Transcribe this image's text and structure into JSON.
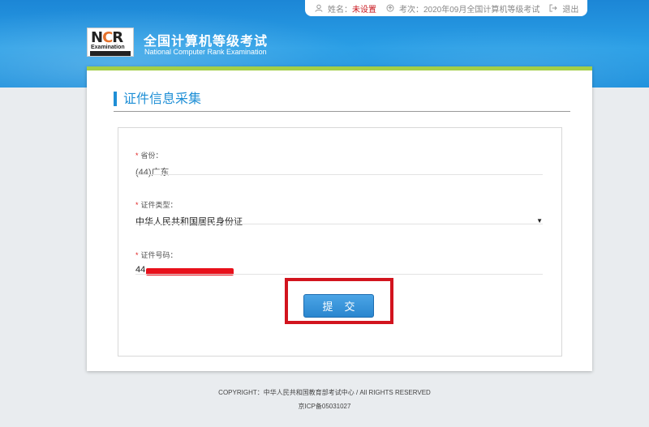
{
  "topbar": {
    "name_label": "姓名：",
    "name_value": "未设置",
    "exam_label": "考次：",
    "exam_value": "2020年09月全国计算机等级考试",
    "logout": "退出"
  },
  "brand": {
    "logo_text": "NCRE",
    "logo_sub": "Examination",
    "title_cn": "全国计算机等级考试",
    "title_en": "National Computer Rank Examination"
  },
  "section": {
    "title": "证件信息采集"
  },
  "form": {
    "province": {
      "label": "省份：",
      "value": "(44)广东"
    },
    "id_type": {
      "label": "证件类型：",
      "value": "中华人民共和国居民身份证"
    },
    "id_number": {
      "label": "证件号码：",
      "value": "44"
    },
    "submit": "提交"
  },
  "footer": {
    "copyright": "COPYRIGHT：中华人民共和国教育部考试中心 / All RIGHTS RESERVED",
    "icp": "京ICP备05031027"
  },
  "colors": {
    "header_blue": "#2a9fe6",
    "accent_green": "#a3cf47",
    "title_blue": "#1f8fd6",
    "highlight_red": "#d2141e"
  }
}
